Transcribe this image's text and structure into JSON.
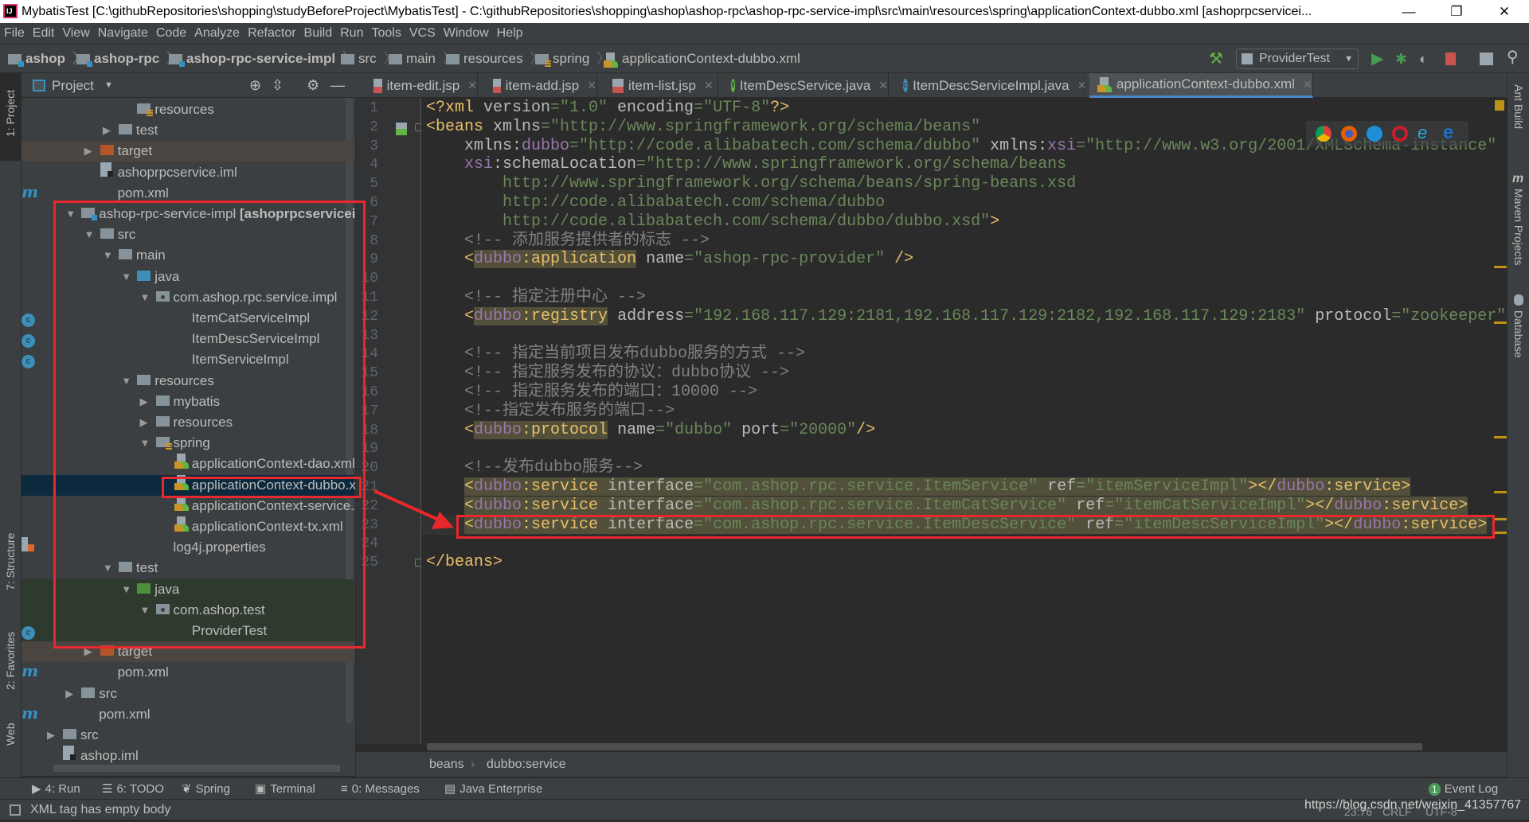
{
  "window": {
    "title": "MybatisTest [C:\\githubRepositories\\shopping\\studyBeforeProject\\MybatisTest] - C:\\githubRepositories\\shopping\\ashop\\ashop-rpc\\ashop-rpc-service-impl\\src\\main\\resources\\spring\\applicationContext-dubbo.xml [ashoprpcservicei...",
    "minimize": "—",
    "restore": "❐",
    "close": "✕"
  },
  "menu": [
    "File",
    "Edit",
    "View",
    "Navigate",
    "Code",
    "Analyze",
    "Refactor",
    "Build",
    "Run",
    "Tools",
    "VCS",
    "Window",
    "Help"
  ],
  "navbar": {
    "crumbs": [
      "ashop",
      "ashop-rpc",
      "ashop-rpc-service-impl",
      "src",
      "main",
      "resources",
      "spring",
      "applicationContext-dubbo.xml"
    ],
    "run_config": "ProviderTest"
  },
  "project_panel": {
    "title": "Project",
    "rows": [
      {
        "label": "resources",
        "level": 4,
        "icon": "folder-res",
        "arrow": "none"
      },
      {
        "label": "test",
        "level": 3,
        "icon": "folder",
        "arrow": "right"
      },
      {
        "label": "target",
        "level": 2,
        "icon": "folder-target",
        "arrow": "right",
        "bg": "target"
      },
      {
        "label": "ashoprpcservice.iml",
        "level": 2,
        "icon": "iml",
        "arrow": "none"
      },
      {
        "label": "pom.xml",
        "level": 2,
        "icon": "maven",
        "arrow": "none"
      },
      {
        "label": "ashop-rpc-service-impl",
        "suffix": "[ashoprpcserviceimpl]",
        "level": 1,
        "icon": "folder-mod",
        "arrow": "down"
      },
      {
        "label": "src",
        "level": 2,
        "icon": "folder",
        "arrow": "down"
      },
      {
        "label": "main",
        "level": 3,
        "icon": "folder",
        "arrow": "down"
      },
      {
        "label": "java",
        "level": 4,
        "icon": "folder-java",
        "arrow": "down"
      },
      {
        "label": "com.ashop.rpc.service.impl",
        "level": 5,
        "icon": "package",
        "arrow": "down"
      },
      {
        "label": "ItemCatServiceImpl",
        "level": 6,
        "icon": "class",
        "arrow": "none"
      },
      {
        "label": "ItemDescServiceImpl",
        "level": 6,
        "icon": "class",
        "arrow": "none"
      },
      {
        "label": "ItemServiceImpl",
        "level": 6,
        "icon": "class",
        "arrow": "none"
      },
      {
        "label": "resources",
        "level": 4,
        "icon": "folder",
        "arrow": "down"
      },
      {
        "label": "mybatis",
        "level": 5,
        "icon": "folder",
        "arrow": "right"
      },
      {
        "label": "resources",
        "level": 5,
        "icon": "folder",
        "arrow": "right"
      },
      {
        "label": "spring",
        "level": 5,
        "icon": "folder-res",
        "arrow": "down"
      },
      {
        "label": "applicationContext-dao.xml",
        "level": 6,
        "icon": "spring-xml",
        "arrow": "none"
      },
      {
        "label": "applicationContext-dubbo.xml",
        "level": 6,
        "icon": "spring-xml",
        "arrow": "none",
        "bg": "selected"
      },
      {
        "label": "applicationContext-service.xml",
        "level": 6,
        "icon": "spring-xml",
        "arrow": "none"
      },
      {
        "label": "applicationContext-tx.xml",
        "level": 6,
        "icon": "spring-xml",
        "arrow": "none"
      },
      {
        "label": "log4j.properties",
        "level": 5,
        "icon": "properties",
        "arrow": "none"
      },
      {
        "label": "test",
        "level": 3,
        "icon": "folder",
        "arrow": "down"
      },
      {
        "label": "java",
        "level": 4,
        "icon": "folder-test-java",
        "arrow": "down",
        "bg": "test"
      },
      {
        "label": "com.ashop.test",
        "level": 5,
        "icon": "package",
        "arrow": "down",
        "bg": "test"
      },
      {
        "label": "ProviderTest",
        "level": 6,
        "icon": "class",
        "arrow": "none",
        "bg": "test"
      },
      {
        "label": "target",
        "level": 2,
        "icon": "folder-target",
        "arrow": "right",
        "bg": "target"
      },
      {
        "label": "pom.xml",
        "level": 2,
        "icon": "maven",
        "arrow": "none"
      },
      {
        "label": "src",
        "level": 1,
        "icon": "folder",
        "arrow": "right"
      },
      {
        "label": "pom.xml",
        "level": 1,
        "icon": "maven",
        "arrow": "none"
      },
      {
        "label": "src",
        "level": 0,
        "icon": "folder",
        "arrow": "right"
      },
      {
        "label": "ashop.iml",
        "level": 0,
        "icon": "iml",
        "arrow": "none"
      }
    ]
  },
  "tabs": [
    {
      "label": "item-edit.jsp",
      "icon": "jsp"
    },
    {
      "label": "item-add.jsp",
      "icon": "jsp"
    },
    {
      "label": "item-list.jsp",
      "icon": "jsp"
    },
    {
      "label": "ItemDescService.java",
      "icon": "interface"
    },
    {
      "label": "ItemDescServiceImpl.java",
      "icon": "class"
    },
    {
      "label": "applicationContext-dubbo.xml",
      "icon": "spring-xml",
      "active": true
    }
  ],
  "editor": {
    "caret_line": 23,
    "lines": [
      [
        [
          "t",
          "<?xml "
        ],
        [
          "a",
          "version"
        ],
        [
          "v",
          "=\"1.0\" "
        ],
        [
          "a",
          "encoding"
        ],
        [
          "v",
          "=\"UTF-8\""
        ],
        [
          "t",
          "?>"
        ]
      ],
      [
        [
          "t",
          "<beans "
        ],
        [
          "a",
          "xmlns"
        ],
        [
          "v",
          "=\"http://www.springframework.org/schema/beans\""
        ]
      ],
      [
        [
          "a",
          "    xmlns:"
        ],
        [
          "ns",
          "dubbo"
        ],
        [
          "v",
          "=\"http://code.alibabatech.com/schema/dubbo\" "
        ],
        [
          "a",
          "xmlns:"
        ],
        [
          "ns",
          "xsi"
        ],
        [
          "v",
          "=\"http://www.w3.org/2001/XMLSchema-instance\""
        ]
      ],
      [
        [
          "ns",
          "    xsi"
        ],
        [
          "a",
          ":schemaLocation"
        ],
        [
          "v",
          "=\"http://www.springframework.org/schema/beans"
        ]
      ],
      [
        [
          "v",
          "        http://www.springframework.org/schema/beans/spring-beans.xsd"
        ]
      ],
      [
        [
          "v",
          "        http://code.alibabatech.com/schema/dubbo"
        ]
      ],
      [
        [
          "v",
          "        http://code.alibabatech.com/schema/dubbo/dubbo.xsd\""
        ],
        [
          "t",
          ">"
        ]
      ],
      [
        [
          "c",
          "    <!-- 添加服务提供者的标志 -->"
        ]
      ],
      [
        [
          "t",
          "    <"
        ],
        [
          "ns",
          "dubbo",
          "hl"
        ],
        [
          "t",
          ":application",
          "hl"
        ],
        [
          "a",
          " name"
        ],
        [
          "v",
          "=\"ashop-rpc-provider\" "
        ],
        [
          "t",
          "/>"
        ]
      ],
      [],
      [
        [
          "c",
          "    <!-- 指定注册中心 -->"
        ]
      ],
      [
        [
          "t",
          "    <"
        ],
        [
          "ns",
          "dubbo",
          "hl"
        ],
        [
          "t",
          ":registry",
          "hl"
        ],
        [
          "a",
          " address"
        ],
        [
          "v",
          "=\"192.168.117.129:2181,192.168.117.129:2182,192.168.117.129:2183\" "
        ],
        [
          "a",
          "protocol"
        ],
        [
          "v",
          "=\"zookeeper\""
        ]
      ],
      [],
      [
        [
          "c",
          "    <!-- 指定当前项目发布dubbo服务的方式 -->"
        ]
      ],
      [
        [
          "c",
          "    <!-- 指定服务发布的协议：dubbo协议 -->"
        ]
      ],
      [
        [
          "c",
          "    <!-- 指定服务发布的端口：10000 -->"
        ]
      ],
      [
        [
          "c",
          "    <!--指定发布服务的端口-->"
        ]
      ],
      [
        [
          "t",
          "    <"
        ],
        [
          "ns",
          "dubbo",
          "hl"
        ],
        [
          "t",
          ":protocol",
          "hl"
        ],
        [
          "a",
          " name"
        ],
        [
          "v",
          "=\"dubbo\" "
        ],
        [
          "a",
          "port"
        ],
        [
          "v",
          "=\"20000\""
        ],
        [
          "t",
          "/>"
        ]
      ],
      [],
      [
        [
          "c",
          "    <!--发布dubbo服务-->"
        ]
      ],
      [
        [
          "x",
          "    "
        ],
        [
          "t",
          "<",
          "hl"
        ],
        [
          "ns",
          "dubbo",
          "hl"
        ],
        [
          "t",
          ":service ",
          "hl"
        ],
        [
          "a",
          "interface",
          "hl"
        ],
        [
          "v",
          "=\"com.ashop.rpc.service.ItemService\" ",
          "hl"
        ],
        [
          "a",
          "ref",
          "hl"
        ],
        [
          "v",
          "=\"itemServiceImpl\"",
          "hl"
        ],
        [
          "t",
          "></",
          "hl"
        ],
        [
          "ns",
          "dubbo",
          "hl"
        ],
        [
          "t",
          ":service>",
          "hl"
        ]
      ],
      [
        [
          "x",
          "    "
        ],
        [
          "t",
          "<",
          "hl"
        ],
        [
          "ns",
          "dubbo",
          "hl"
        ],
        [
          "t",
          ":service ",
          "hl"
        ],
        [
          "a",
          "interface",
          "hl"
        ],
        [
          "v",
          "=\"com.ashop.rpc.service.ItemCatService\" ",
          "hl"
        ],
        [
          "a",
          "ref",
          "hl"
        ],
        [
          "v",
          "=\"itemCatServiceImpl\"",
          "hl"
        ],
        [
          "t",
          "></",
          "hl"
        ],
        [
          "ns",
          "dubbo",
          "hl"
        ],
        [
          "t",
          ":service>",
          "hl"
        ]
      ],
      [
        [
          "x",
          "    "
        ],
        [
          "t",
          "<",
          "hl"
        ],
        [
          "ns",
          "dubbo",
          "hl"
        ],
        [
          "t",
          ":service ",
          "hl"
        ],
        [
          "a",
          "interface",
          "hl"
        ],
        [
          "v",
          "=\"com.ashop.rpc.service.ItemDescService\" ",
          "hl"
        ],
        [
          "a",
          "ref",
          "hl"
        ],
        [
          "v",
          "=\"itemDescServiceImpl\"",
          "hl"
        ],
        [
          "t",
          "></",
          "hl"
        ],
        [
          "ns",
          "dubbo",
          "hl"
        ],
        [
          "t",
          ":service>",
          "hl"
        ]
      ],
      [],
      [
        [
          "t",
          "</beans>"
        ]
      ]
    ],
    "breadcrumb": [
      "beans",
      "dubbo:service"
    ]
  },
  "left_stripe": [
    "1: Project",
    "7: Structure",
    "2: Favorites",
    "Web"
  ],
  "right_stripe": [
    "Ant Build",
    "Maven Projects",
    "Database"
  ],
  "tool_windows": [
    "4: Run",
    "6: TODO",
    "Spring",
    "Terminal",
    "0: Messages",
    "Java Enterprise"
  ],
  "event_log": {
    "label": "Event Log",
    "count": "1"
  },
  "status": {
    "message": "XML tag has empty body",
    "position": "23:76",
    "line_sep": "CRLF",
    "encoding": "UTF-8",
    "watermark": "https://blog.csdn.net/weixin_41357767"
  },
  "colors": {
    "highlight": "#e8282c",
    "accent": "#4a88c7",
    "selection": "#0d293e"
  }
}
